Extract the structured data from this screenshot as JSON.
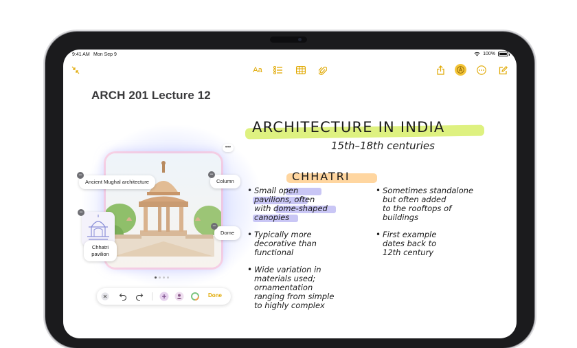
{
  "status_bar": {
    "time": "9:41 AM",
    "date": "Mon Sep 9",
    "battery": "100%"
  },
  "toolbar": {
    "format_label": "Aa",
    "icons": [
      "collapse-icon",
      "format-icon",
      "checklist-icon",
      "table-icon",
      "attachment-icon",
      "share-icon",
      "markup-icon",
      "more-icon",
      "compose-icon"
    ],
    "accent": "#e0a800"
  },
  "note": {
    "title": "ARCH 201 Lecture 12",
    "heading": "ARCHITECTURE IN INDIA",
    "subheading": "15th–18th centuries",
    "section": "CHHATRI",
    "bullets_left": [
      [
        "Small open",
        "pavilions, often",
        "with dome-shaped",
        "canopies"
      ],
      [
        "Typically more",
        "decorative than",
        "functional"
      ],
      [
        "Wide variation in",
        "materials used;",
        "ornamentation",
        "ranging from simple",
        "to highly complex"
      ]
    ],
    "bullets_right": [
      [
        "Sometimes standalone",
        "but often added",
        "to the rooftops of",
        "buildings"
      ],
      [
        "First example",
        "dates back to",
        "12th century"
      ]
    ],
    "highlight_colors": {
      "heading": "#d8ee6a",
      "section": "#ffd6a0",
      "words": "#c9c6f5"
    }
  },
  "image_playground": {
    "chips": [
      "Ancient Mughal architecture",
      "Column",
      "Dome",
      "Chhatri pavilion"
    ],
    "page_dots": 4,
    "active_dot": 0,
    "done_label": "Done"
  }
}
